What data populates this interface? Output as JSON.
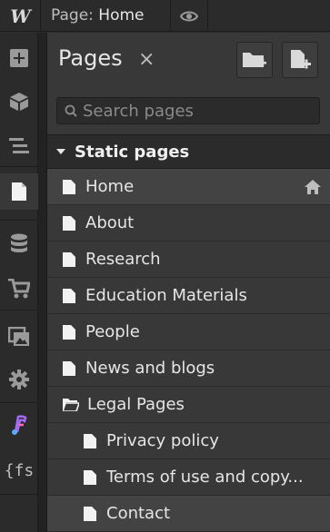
{
  "topbar": {
    "page_prefix": "Page:",
    "page_name": "Home"
  },
  "rail": {
    "items": [
      {
        "icon": "add-panel-icon"
      },
      {
        "icon": "components-icon"
      },
      {
        "icon": "navigator-icon"
      },
      {
        "icon": "pages-icon",
        "active": true
      },
      {
        "icon": "cms-icon"
      },
      {
        "icon": "ecommerce-icon"
      },
      {
        "icon": "assets-icon"
      },
      {
        "icon": "settings-icon"
      },
      {
        "icon": "integration-icon"
      },
      {
        "icon": "finsweet-icon",
        "label": "{fs"
      }
    ]
  },
  "panel": {
    "title": "Pages",
    "close": "×",
    "search_placeholder": "Search pages"
  },
  "section": {
    "label": "Static pages"
  },
  "pages": [
    {
      "label": "Home",
      "selected": true,
      "home": true
    },
    {
      "label": "About"
    },
    {
      "label": "Research"
    },
    {
      "label": "Education Materials"
    },
    {
      "label": "People"
    },
    {
      "label": "News and blogs"
    },
    {
      "label": "Legal Pages",
      "folder": true
    },
    {
      "label": "Privacy policy",
      "child": true
    },
    {
      "label": "Terms of use and copy...",
      "child": true
    },
    {
      "label": "Contact",
      "child": true,
      "selected": true
    }
  ],
  "colors": {
    "accent_integration": "#a46bf5"
  }
}
